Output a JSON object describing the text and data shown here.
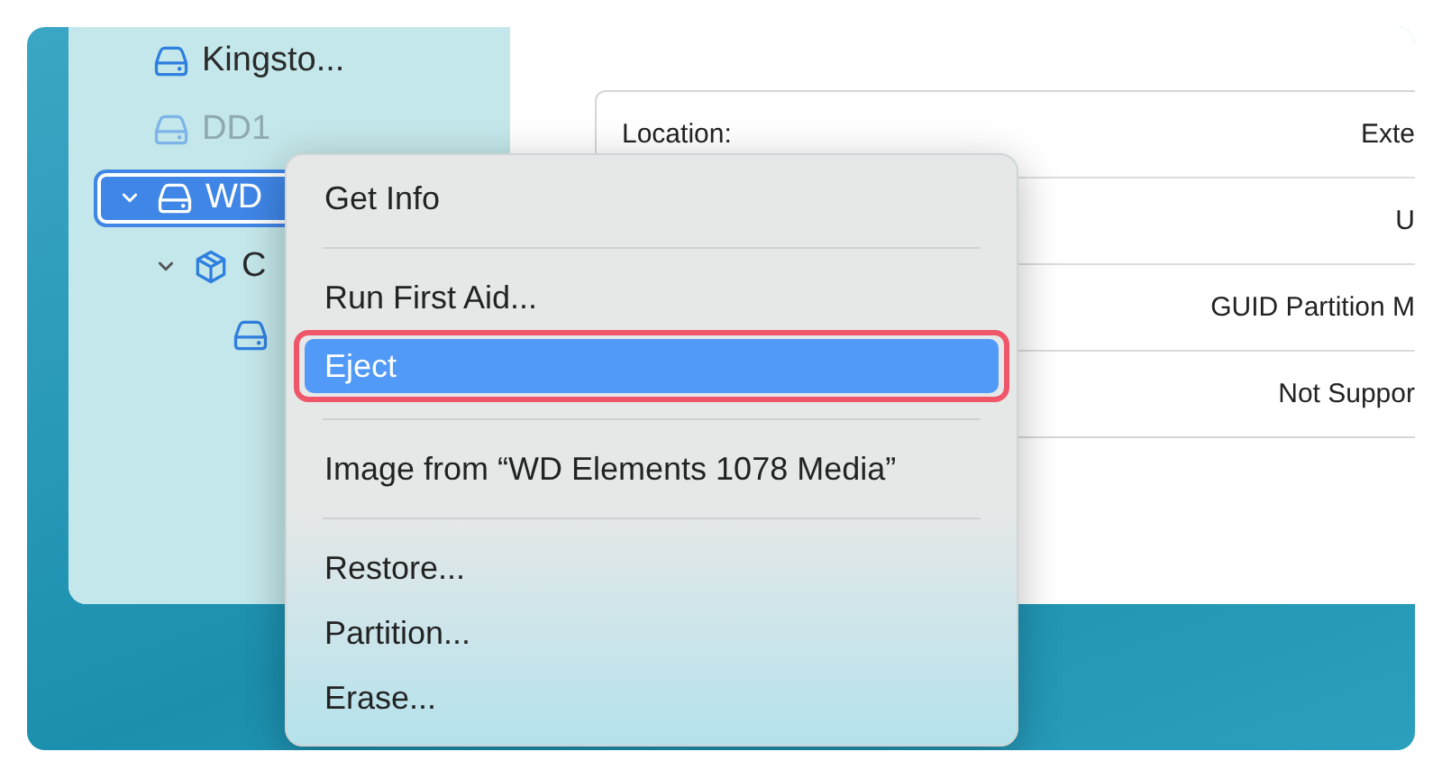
{
  "sidebar": {
    "items": [
      {
        "kind": "drive",
        "label": "Kingsto...",
        "expanded": false,
        "selected": false,
        "dimmed": false
      },
      {
        "kind": "drive",
        "label": "DD1",
        "expanded": false,
        "selected": false,
        "dimmed": true
      },
      {
        "kind": "drive",
        "label": "WD",
        "expanded": true,
        "selected": true,
        "dimmed": false,
        "children": [
          {
            "kind": "container",
            "label": "C",
            "expanded": true,
            "selected": false,
            "dimmed": false,
            "children": [
              {
                "kind": "drive",
                "expanded": false,
                "selected": false,
                "dimmed": false
              }
            ]
          }
        ]
      }
    ]
  },
  "info_table": {
    "rows": [
      {
        "label": "Location:",
        "value": "Exte"
      },
      {
        "value": "U"
      },
      {
        "value": "GUID Partition M"
      },
      {
        "value": "Not Suppor"
      }
    ]
  },
  "context_menu": {
    "items": [
      {
        "kind": "item",
        "label": "Get Info",
        "selected": false,
        "outlined": false
      },
      {
        "kind": "separator"
      },
      {
        "kind": "item",
        "label": "Run First Aid...",
        "selected": false,
        "outlined": false
      },
      {
        "kind": "item",
        "label": "Eject",
        "selected": true,
        "outlined": true
      },
      {
        "kind": "separator"
      },
      {
        "kind": "item",
        "label": "Image from “WD Elements 1078 Media”",
        "selected": false,
        "outlined": false
      },
      {
        "kind": "separator"
      },
      {
        "kind": "item",
        "label": "Restore...",
        "selected": false,
        "outlined": false
      },
      {
        "kind": "item",
        "label": "Partition...",
        "selected": false,
        "outlined": false
      },
      {
        "kind": "item",
        "label": "Erase...",
        "selected": false,
        "outlined": false
      }
    ]
  }
}
